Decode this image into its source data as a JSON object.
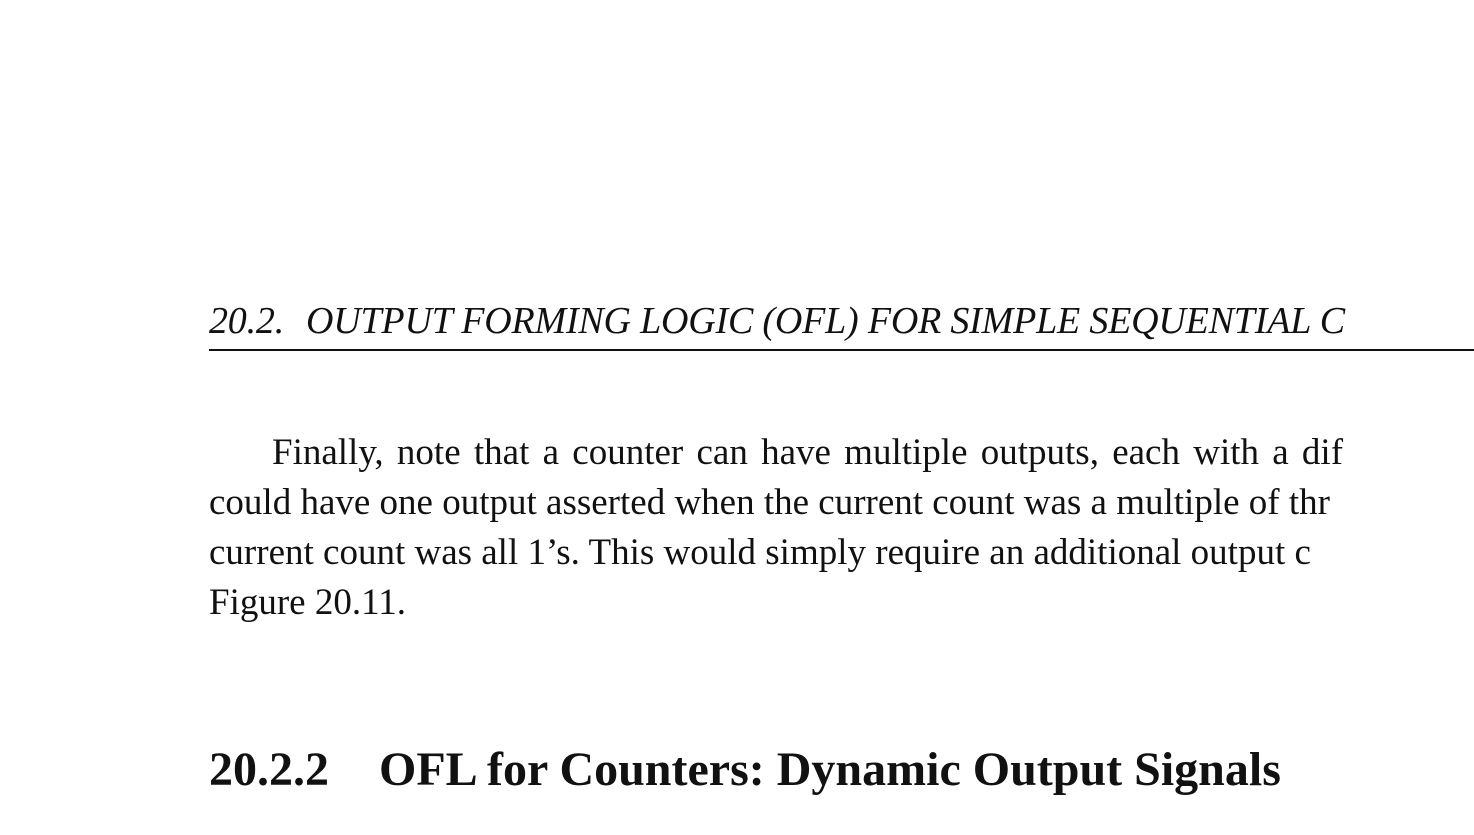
{
  "running_header": {
    "section_number": "20.2.",
    "title": "OUTPUT FORMING LOGIC (OFL) FOR SIMPLE SEQUENTIAL C"
  },
  "paragraph": {
    "lines": [
      "Finally, note that a counter can have multiple outputs, each with a dif",
      "could have one output asserted when the current count was a multiple of thr",
      "current count was all 1’s.  This would simply require an additional output c",
      "Figure 20.11."
    ]
  },
  "section_heading": {
    "number": "20.2.2",
    "title": "OFL for Counters: Dynamic Output Signals"
  }
}
